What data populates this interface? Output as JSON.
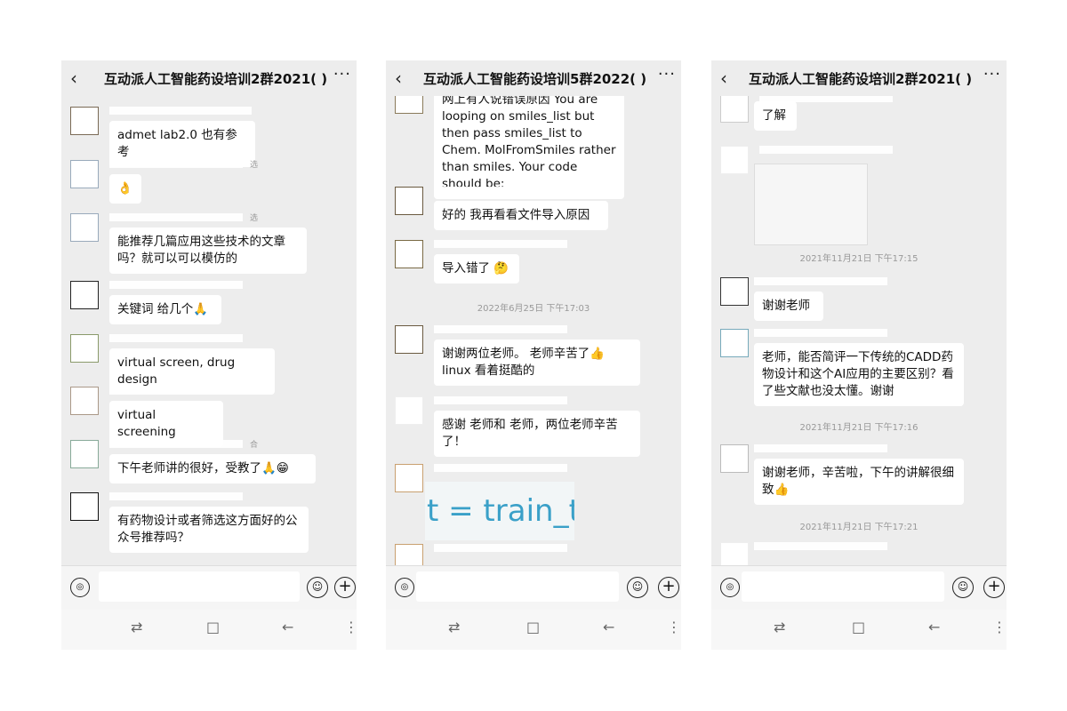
{
  "phones": [
    {
      "title": "互动派人工智能药设培训2群2021(    )",
      "messages": [
        {
          "tail": "",
          "text": "admet lab2.0 也有参考"
        },
        {
          "tail": "选",
          "text": "👌"
        },
        {
          "tail": "选",
          "text": "能推荐几篇应用这些技术的文章吗？就可以可以模仿的"
        },
        {
          "tail": "",
          "text": "关键词 给几个🙏"
        },
        {
          "tail": "",
          "text": "virtual screen, drug design"
        },
        {
          "tail": "",
          "text": "virtual screening"
        },
        {
          "tail": "合",
          "text": "下午老师讲的很好，受教了🙏😁"
        },
        {
          "tail": "",
          "text": "有药物设计或者筛选这方面好的公众号推荐吗？"
        }
      ]
    },
    {
      "title": "互动派人工智能药设培训5群2022(    )",
      "messages": [
        {
          "text": "网上有人说错误原因 You are looping on smiles_list but then pass smiles_list to Chem. MolFromSmiles rather than smiles. Your code should be:"
        },
        {
          "text": "好的 我再看看文件导入原因"
        },
        {
          "text": "导入错了 🤔"
        },
        {
          "text": "谢谢两位老师。   老师辛苦了👍 linux 看着挺酷的"
        },
        {
          "text": "感谢    老师和    老师，两位老师辛苦了！"
        },
        {
          "text": "t = train_te"
        }
      ],
      "timestamp": "2022年6月25日 下午17:03"
    },
    {
      "title": "互动派人工智能药设培训2群2021(    )",
      "messages": [
        {
          "text": "了解"
        },
        {
          "text": "谢谢老师"
        },
        {
          "text": "老师，能否简评一下传统的CADD药物设计和这个AI应用的主要区别？看了些文献也没太懂。谢谢"
        },
        {
          "text": "谢谢老师，辛苦啦，下午的讲解很细致👍"
        }
      ],
      "timestamps": [
        "2021年11月21日 下午17:15",
        "2021年11月21日 下午17:16",
        "2021年11月21日 下午17:21"
      ]
    }
  ],
  "icons": {
    "back": "‹",
    "more": "···",
    "voice": "◎",
    "emoji": "☺",
    "plus": "+",
    "nav_switch": "⇄",
    "nav_home": "□",
    "nav_back": "←",
    "nav_menu": "⋮"
  }
}
